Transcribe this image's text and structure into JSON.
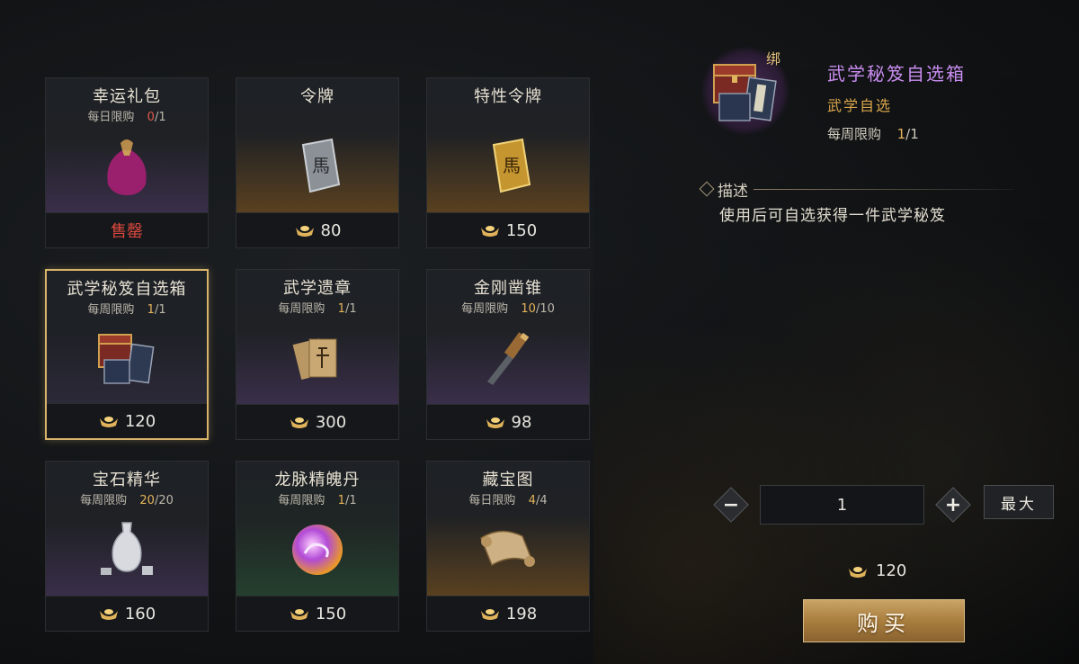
{
  "items": [
    {
      "name": "幸运礼包",
      "limit_label": "每日限购",
      "count": "0",
      "total": "1",
      "count_status": "red",
      "price": null,
      "status_text": "售罄",
      "theme": "purple",
      "icon": "pouch-icon"
    },
    {
      "name": "令牌",
      "limit_label": "",
      "count": "",
      "total": "",
      "count_status": "",
      "price": "80",
      "status_text": "",
      "theme": "gold",
      "icon": "silver-token-icon"
    },
    {
      "name": "特性令牌",
      "limit_label": "",
      "count": "",
      "total": "",
      "count_status": "",
      "price": "150",
      "status_text": "",
      "theme": "gold",
      "icon": "gold-token-icon"
    },
    {
      "name": "武学秘笈自选箱",
      "limit_label": "每周限购",
      "count": "1",
      "total": "1",
      "count_status": "gold",
      "price": "120",
      "status_text": "",
      "theme": "dark",
      "icon": "chest-icon",
      "selected": true
    },
    {
      "name": "武学遗章",
      "limit_label": "每周限购",
      "count": "1",
      "total": "1",
      "count_status": "gold",
      "price": "300",
      "status_text": "",
      "theme": "purple",
      "icon": "scroll-pages-icon"
    },
    {
      "name": "金刚凿锥",
      "limit_label": "每周限购",
      "count": "10",
      "total": "10",
      "count_status": "gold",
      "price": "98",
      "status_text": "",
      "theme": "purple",
      "icon": "chisel-icon"
    },
    {
      "name": "宝石精华",
      "limit_label": "每周限购",
      "count": "20",
      "total": "20",
      "count_status": "gold",
      "price": "160",
      "status_text": "",
      "theme": "purple",
      "icon": "vase-icon"
    },
    {
      "name": "龙脉精魄丹",
      "limit_label": "每周限购",
      "count": "1",
      "total": "1",
      "count_status": "gold",
      "price": "150",
      "status_text": "",
      "theme": "green",
      "icon": "orb-icon"
    },
    {
      "name": "藏宝图",
      "limit_label": "每日限购",
      "count": "4",
      "total": "4",
      "count_status": "gold",
      "price": "198",
      "status_text": "",
      "theme": "gold",
      "icon": "map-scroll-icon"
    }
  ],
  "detail": {
    "bind_tag": "绑",
    "title": "武学秘笈自选箱",
    "subtitle": "武学自选",
    "limit_label": "每周限购",
    "count": "1",
    "total": "1",
    "desc_label": "描述",
    "desc_text": "使用后可自选获得一件武学秘笈"
  },
  "purchase": {
    "minus": "−",
    "plus": "+",
    "quantity": "1",
    "max_label": "最大",
    "total_price": "120",
    "buy_label": "购买"
  },
  "colors": {
    "accent_gold": "#e6b45a",
    "sold_out_red": "#d9483f",
    "title_purple": "#c98df0"
  }
}
